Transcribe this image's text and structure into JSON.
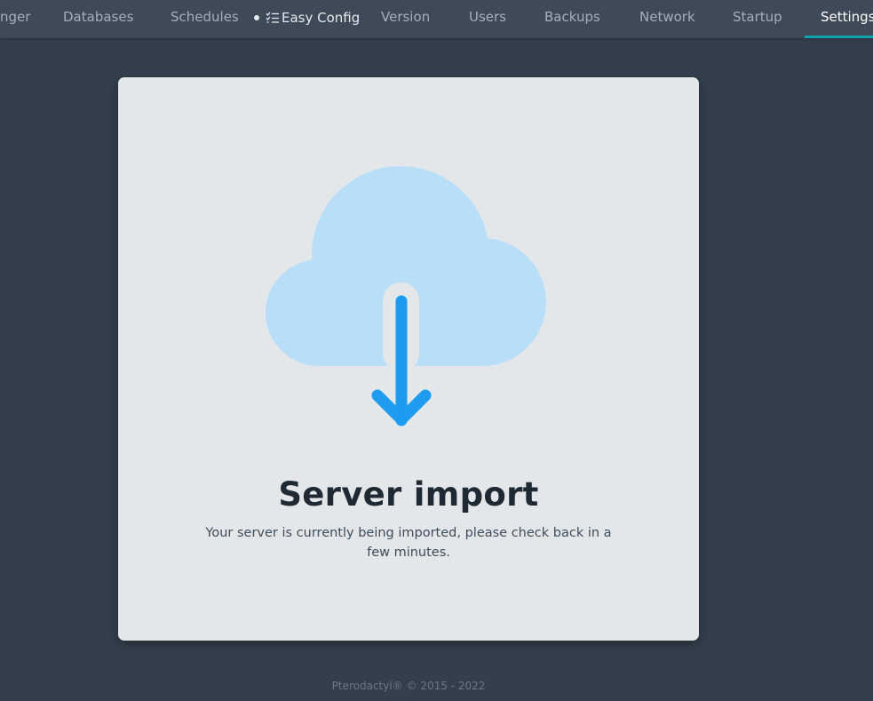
{
  "nav": {
    "items": [
      {
        "label": "nger"
      },
      {
        "label": "Databases"
      },
      {
        "label": "Schedules"
      },
      {
        "label": "Easy Config"
      },
      {
        "label": "Version"
      },
      {
        "label": "Users"
      },
      {
        "label": "Backups"
      },
      {
        "label": "Network"
      },
      {
        "label": "Startup"
      },
      {
        "label": "Settings"
      }
    ],
    "active": "Settings",
    "easy_config_icon": "list-check-icon"
  },
  "main": {
    "illustration_icon": "cloud-download-icon",
    "title": "Server import",
    "message": "Your server is currently being imported, please check back in a few minutes."
  },
  "footer": {
    "text": "Pterodactyl® © 2015 - 2022"
  },
  "colors": {
    "background": "#333f4d",
    "nav_background": "#3e4a58",
    "card_background": "#e4e7ea",
    "accent": "#0fa3b1",
    "cloud": "#b9dff8",
    "arrow": "#1c9cf0"
  }
}
